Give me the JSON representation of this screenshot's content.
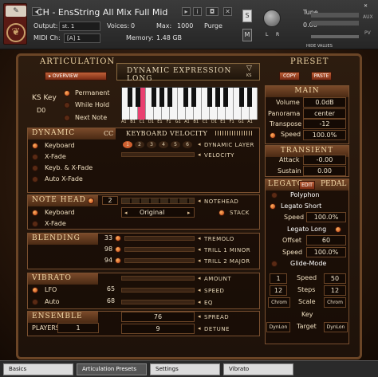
{
  "header": {
    "instrument_title": "CH - EnsString All Mix Full Mid",
    "output_label": "Output:",
    "output_value": "st. 1",
    "voices_label": "Voices:",
    "voices_value": "0",
    "max_label": "Max:",
    "max_value": "1000",
    "purge_label": "Purge",
    "midi_label": "MIDI Ch:",
    "midi_value": "[A]  1",
    "memory_label": "Memory:",
    "memory_value": "1.48 GB",
    "tune_label": "Tune",
    "tune_value": "0.00",
    "s_label": "S",
    "m_label": "M",
    "aux_label": "AUX",
    "pv_label": "PV",
    "hide_values": "HIDE VALUES"
  },
  "articulation": {
    "title": "ARTICULATION",
    "overview_btn": "OVERVIEW",
    "current": "DYNAMIC EXPRESSION LONG",
    "ks_label": "KS",
    "ks_key_label": "KS Key",
    "ks_key_value": "D0",
    "modes": [
      "Permanent",
      "While Hold",
      "Next Note"
    ]
  },
  "preset": {
    "title": "PRESET",
    "copy_btn": "COPY",
    "paste_btn": "PASTE"
  },
  "keyboard_labels": [
    "A1",
    "B1",
    "C1",
    "D1",
    "E1",
    "F1",
    "G1",
    "A1",
    "B1",
    "C1",
    "D1",
    "E1",
    "F1",
    "G1",
    "A1"
  ],
  "dynamic": {
    "title": "DYNAMIC",
    "cc_label": "CC",
    "kv_title": "KEYBOARD VELOCITY",
    "options": [
      "Keyboard",
      "X-Fade",
      "Keyb. & X-Fade",
      "Auto X-Fade"
    ],
    "layer_steps": [
      "1",
      "2",
      "3",
      "4",
      "5",
      "6"
    ],
    "dynamic_layer_label": "DYNAMIC LAYER",
    "velocity_label": "VELOCITY"
  },
  "main": {
    "title": "MAIN",
    "volume_label": "Volume",
    "volume_value": "0.0dB",
    "panorama_label": "Panorama",
    "panorama_value": "center",
    "transpose_label": "Transpose",
    "transpose_value": "-12",
    "speed_label": "Speed",
    "speed_value": "100.0%"
  },
  "transient": {
    "title": "TRANSIENT",
    "attack_label": "Attack",
    "attack_value": "-0.00",
    "sustain_label": "Sustain",
    "sustain_value": "0.00"
  },
  "notehead": {
    "title": "NOTE HEAD",
    "count_value": "2",
    "notehead_label": "NOTEHEAD",
    "options": [
      "Keyboard",
      "X-Fade"
    ],
    "mode_value": "Original",
    "stack_label": "STACK"
  },
  "legato": {
    "title": "LEGATO",
    "edit_label": "EDIT",
    "pedal_label": "PEDAL",
    "polyphon_label": "Polyphon",
    "short_label": "Legato Short",
    "short_speed_label": "Speed",
    "short_speed_value": "100.0%",
    "long_label": "Legato Long",
    "offset_label": "Offset",
    "offset_value": "60",
    "long_speed_label": "Speed",
    "long_speed_value": "100.0%",
    "glide_label": "Glide-Mode",
    "glide_left_value": "1",
    "glide_speed_label": "Speed",
    "glide_speed_value": "50",
    "glide_12_value": "12",
    "steps_label": "Steps",
    "steps_value": "12",
    "chrom_left": "Chrom",
    "scale_label": "Scale",
    "chrom_right": "Chrom",
    "key_label": "Key",
    "dynlon_left": "DynLon",
    "target_label": "Target",
    "dynlon_right": "DynLon"
  },
  "blending": {
    "title": "BLENDING",
    "rows": [
      {
        "value": "33",
        "label": "TREMOLO"
      },
      {
        "value": "98",
        "label": "TRILL 1 MINOR"
      },
      {
        "value": "94",
        "label": "TRILL 2 MAJOR"
      }
    ]
  },
  "vibrato": {
    "title": "VIBRATO",
    "lfo_label": "LFO",
    "auto_label": "Auto",
    "amount_label": "AMOUNT",
    "speed_value": "65",
    "speed_label": "SPEED",
    "eq_value": "68",
    "eq_label": "EQ"
  },
  "ensemble": {
    "title": "ENSEMBLE",
    "players_label": "PLAYERS",
    "players_value": "1",
    "spread_value": "76",
    "spread_label": "SPREAD",
    "detune_value": "9",
    "detune_label": "DETUNE"
  },
  "tabs": [
    "Basics",
    "Articulation Presets",
    "Settings",
    "Vibrato"
  ]
}
